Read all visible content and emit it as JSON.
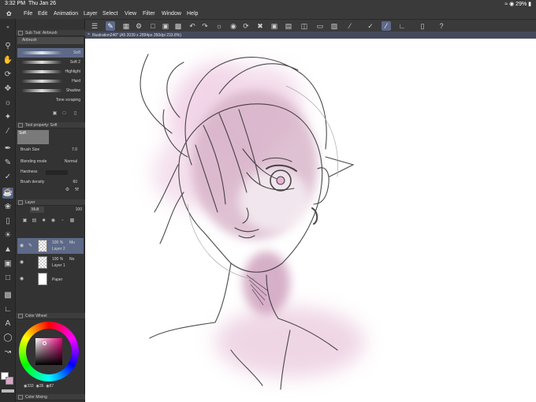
{
  "status": {
    "time": "3:32 PM",
    "date": "Thu Jan 26",
    "battery": "29%"
  },
  "menu": [
    "File",
    "Edit",
    "Animation",
    "Layer",
    "Select",
    "View",
    "Filter",
    "Window",
    "Help"
  ],
  "canvas_tab": {
    "title": "Illustration240* (A5 2039 x 2894px 350dpi 233.8%)"
  },
  "sub_tool": {
    "header": "Sub Tool: Airbrush",
    "group": "Airbrush",
    "brushes": [
      "Soft",
      "Soft 2",
      "Highlight",
      "Hard",
      "Shadow",
      "Tone scraping"
    ],
    "selected": "Soft"
  },
  "tool_property": {
    "header": "Tool property: Soft",
    "brush_name": "Soft",
    "brush_size_label": "Brush Size",
    "brush_size_value": "7.0",
    "blending_label": "Blending mode",
    "blending_value": "Normal",
    "hardness_label": "Hardness",
    "density_label": "Brush density",
    "density_value": "60"
  },
  "layer_panel": {
    "header": "Layer",
    "blend_mode": "Mult",
    "opacity": "100",
    "layers": [
      {
        "opacity": "100 %",
        "mode": "Mu",
        "name": "Layer 2",
        "selected": true
      },
      {
        "opacity": "100 %",
        "mode": "No",
        "name": "Layer 1",
        "selected": false
      },
      {
        "opacity": "",
        "mode": "",
        "name": "Paper",
        "selected": false
      }
    ]
  },
  "color_wheel": {
    "header": "Color Wheel",
    "h": "333",
    "s": "36",
    "v": "87",
    "accent_color": "#d8a6c5"
  },
  "color_mixing": {
    "header": "Color Mixing"
  },
  "colors": {
    "accent": "#5d6987",
    "sketch": "#2b2b2b",
    "blush": "#e7b4d6"
  }
}
